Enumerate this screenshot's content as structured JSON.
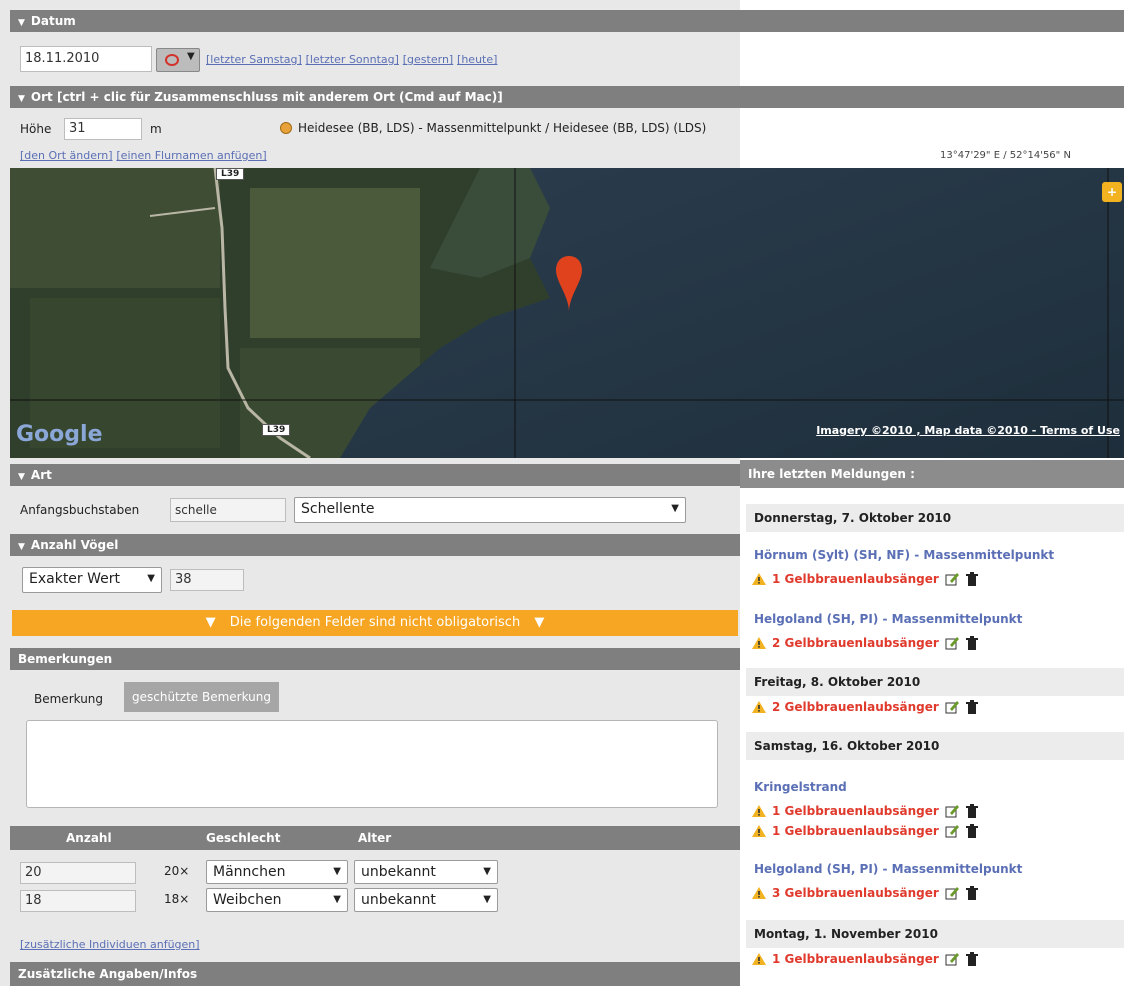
{
  "datum": {
    "header": "Datum",
    "date_value": "18.11.2010",
    "links": [
      "[letzter Samstag]",
      "[letzter Sonntag]",
      "[gestern]",
      "[heute]"
    ]
  },
  "ort": {
    "header": "Ort [ctrl + clic für Zusammenschluss mit anderem Ort (Cmd auf Mac)]",
    "hoehe_label": "Höhe",
    "hoehe_value": "31",
    "hoehe_unit": "m",
    "place_name": "Heidesee (BB, LDS) - Massenmittelpunkt / Heidesee (BB, LDS) (LDS)",
    "link_change": "[den Ort ändern]",
    "link_field": "[einen Flurnamen anfügen]",
    "coordinates": "13°47'29\" E / 52°14'56\" N"
  },
  "map": {
    "road_label_top": "L39",
    "road_label_bottom": "L39",
    "logo": "Google",
    "attribution": "Imagery ©2010 , Map data ©2010 - Terms of Use",
    "zoom_label": "+"
  },
  "art": {
    "header": "Art",
    "label": "Anfangsbuchstaben",
    "input_value": "schelle",
    "species_selected": "Schellente"
  },
  "anzahl": {
    "header": "Anzahl Vögel",
    "mode_selected": "Exakter Wert",
    "value": "38"
  },
  "optional_banner": "Die folgenden Felder sind nicht obligatorisch",
  "bemerkungen": {
    "header": "Bemerkungen",
    "tab_active": "Bemerkung",
    "tab_inactive": "geschützte Bemerkung",
    "text": ""
  },
  "details": {
    "col_anzahl": "Anzahl",
    "col_geschlecht": "Geschlecht",
    "col_alter": "Alter",
    "rows": [
      {
        "count": "20",
        "mult": "20×",
        "sex": "Männchen",
        "age": "unbekannt"
      },
      {
        "count": "18",
        "mult": "18×",
        "sex": "Weibchen",
        "age": "unbekannt"
      }
    ],
    "add_link": "[zusätzliche Individuen anfügen]"
  },
  "zusatz_header": "Zusätzliche Angaben/Infos",
  "recent": {
    "header": "Ihre letzten Meldungen :",
    "day1": "Donnerstag, 7. Oktober 2010",
    "loc1": "Hörnum (Sylt) (SH, NF) - Massenmittelpunkt",
    "rep1": "1 Gelbbrauenlaubsänger",
    "loc2": "Helgoland (SH, PI) - Massenmittelpunkt",
    "rep2": "2 Gelbbrauenlaubsänger",
    "day2": "Freitag, 8. Oktober 2010",
    "rep3": "2 Gelbbrauenlaubsänger",
    "day3": "Samstag, 16. Oktober 2010",
    "loc3": "Kringelstrand",
    "rep4": "1 Gelbbrauenlaubsänger",
    "rep5": "1 Gelbbrauenlaubsänger",
    "loc4": "Helgoland (SH, PI) - Massenmittelpunkt",
    "rep6": "3 Gelbbrauenlaubsänger",
    "day4": "Montag, 1. November 2010",
    "rep7": "1 Gelbbrauenlaubsänger"
  },
  "colors": {
    "bar_gray": "#7f7f7f",
    "orange": "#f6a623",
    "link_blue": "#5a6fb5",
    "alert_red": "#e03a2d"
  }
}
